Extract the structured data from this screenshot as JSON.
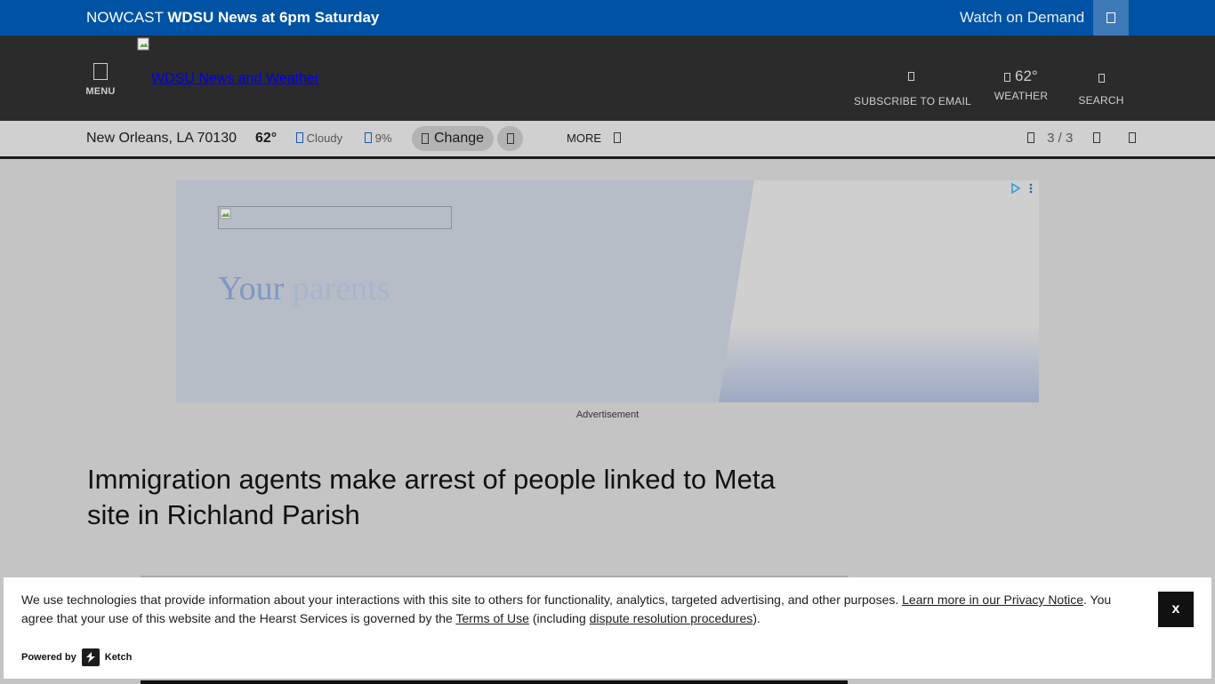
{
  "nowcast": {
    "prefix": "NOWCAST",
    "program": "WDSU News at 6pm Saturday",
    "watch_label": "Watch on Demand",
    "watch_icon": "live-tv-icon"
  },
  "header": {
    "menu_label": "MENU",
    "logo_alt": "WDSU News and Weather",
    "subscribe_label": "SUBSCRIBE TO EMAIL",
    "weather_temp": "62°",
    "weather_label": "WEATHER",
    "search_label": "SEARCH"
  },
  "weather_bar": {
    "location": "New Orleans, LA 70130",
    "temp": "62°",
    "condition": "Cloudy",
    "precip": "9%",
    "change_label": "Change",
    "more_label": "MORE",
    "alerts_count": "3 / 3"
  },
  "ad": {
    "headline_a": "Your",
    "headline_b": "parents",
    "label": "Advertisement",
    "colors": {
      "panel": "#b7bdc6",
      "accent": "#7e98c0"
    }
  },
  "article": {
    "headline": "Immigration agents make arrest of people linked to Meta site in Richland Parish"
  },
  "cookie_banner": {
    "text_1": "We use technologies that provide information about your interactions with this site to others for functionality, analytics, targeted advertising, and other purposes. ",
    "privacy_link": "Learn more in our Privacy Notice",
    "text_2": ". You agree that your use of this website and the Hearst Services is governed by the ",
    "terms_link": "Terms of Use",
    "text_3": " (including ",
    "dispute_link": "dispute resolution procedures",
    "text_4": ").",
    "close_label": "x",
    "powered_by": "Powered by",
    "brand": "Ketch"
  },
  "colors": {
    "nowcast_bg": "#0052a5",
    "header_bg": "#2b2b2b",
    "page_bg": "#c4c4c4"
  }
}
